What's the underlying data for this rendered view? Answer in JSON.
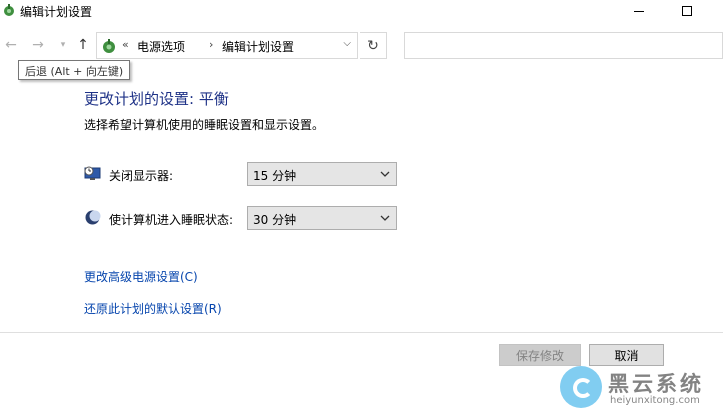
{
  "window": {
    "title": "编辑计划设置",
    "app_icon": "power-options-icon"
  },
  "nav": {
    "back_icon": "arrow-left-icon",
    "forward_icon": "arrow-right-icon",
    "recent_icon": "chevron-down-icon",
    "up_icon": "arrow-up-icon",
    "tooltip": "后退 (Alt + 向左键)"
  },
  "address": {
    "prefix": "«",
    "crumbs": [
      "电源选项",
      "编辑计划设置"
    ],
    "separator": "›",
    "refresh_icon": "refresh-icon"
  },
  "content": {
    "title": "更改计划的设置: 平衡",
    "description": "选择希望计算机使用的睡眠设置和显示设置。",
    "settings": [
      {
        "label": "关闭显示器:",
        "value": "15 分钟",
        "icon": "monitor-clock-icon"
      },
      {
        "label": "使计算机进入睡眠状态:",
        "value": "30 分钟",
        "icon": "moon-icon"
      }
    ],
    "links": {
      "advanced": "更改高级电源设置(C)",
      "restore": "还原此计划的默认设置(R)"
    }
  },
  "buttons": {
    "save": "保存修改",
    "cancel": "取消"
  },
  "watermark": {
    "brand": "黑云系统",
    "url": "heiyunxitong.com"
  },
  "colors": {
    "title_blue": "#1e3287",
    "link_blue": "#0645ad",
    "watermark_blue": "#6cc5ef"
  }
}
